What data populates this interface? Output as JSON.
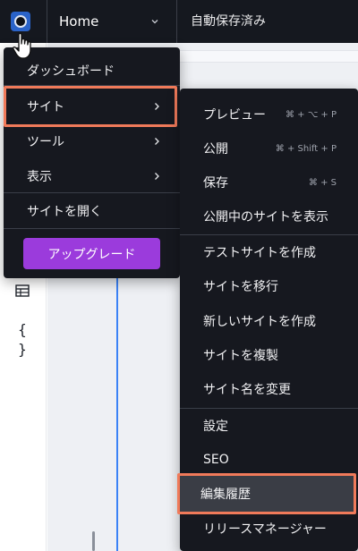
{
  "topbar": {
    "page_name": "Home",
    "autosave_status": "自動保存済み"
  },
  "main_menu": {
    "items": [
      {
        "label": "ダッシュボード"
      },
      {
        "label": "サイト"
      },
      {
        "label": "ツール"
      },
      {
        "label": "表示"
      },
      {
        "label": "サイトを開く"
      }
    ],
    "upgrade_label": "アップグレード"
  },
  "site_submenu": {
    "items": [
      {
        "label": "プレビュー",
        "shortcut": "⌘ + ⌥ + P"
      },
      {
        "label": "公開",
        "shortcut": "⌘ + Shift + P"
      },
      {
        "label": "保存",
        "shortcut": "⌘ + S"
      },
      {
        "label": "公開中のサイトを表示"
      },
      {
        "label": "テストサイトを作成"
      },
      {
        "label": "サイトを移行"
      },
      {
        "label": "新しいサイトを作成"
      },
      {
        "label": "サイトを複製"
      },
      {
        "label": "サイト名を変更"
      },
      {
        "label": "設定"
      },
      {
        "label": "SEO"
      },
      {
        "label": "編集履歴"
      },
      {
        "label": "リリースマネージャー"
      }
    ]
  },
  "left_rail": {
    "icons": [
      "table-icon",
      "braces-icon"
    ],
    "braces_glyph": "{ }"
  },
  "colors": {
    "menu_bg": "#16181f",
    "highlight_border": "#f07a5a",
    "upgrade": "#9b3bdc",
    "logo": "#2a63c9"
  }
}
